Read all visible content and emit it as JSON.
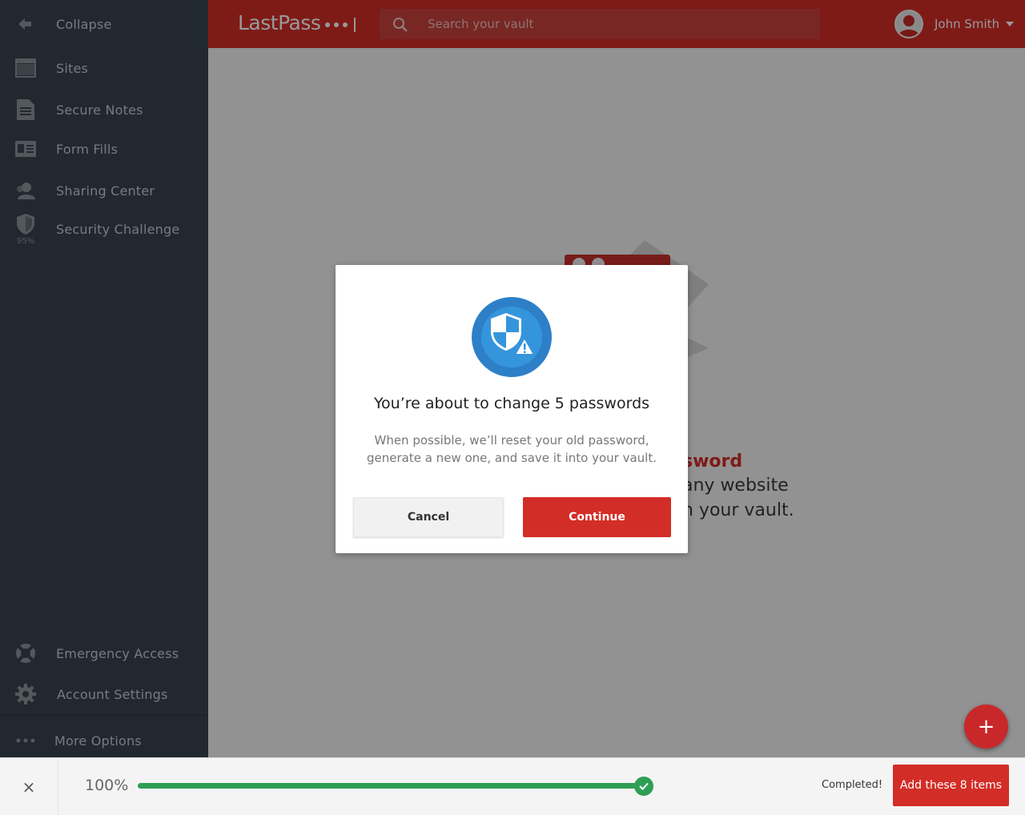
{
  "sidebar": {
    "collapse_label": "Collapse",
    "items": [
      {
        "label": "Sites",
        "icon": "sites-icon"
      },
      {
        "label": "Secure Notes",
        "icon": "secure-notes-icon"
      },
      {
        "label": "Form Fills",
        "icon": "form-fills-icon"
      },
      {
        "label": "Sharing Center",
        "icon": "sharing-center-icon"
      },
      {
        "label": "Security Challenge",
        "icon": "shield-icon",
        "score": "95%"
      }
    ],
    "bottom_items": [
      {
        "label": "Emergency Access",
        "icon": "lifebuoy-icon"
      },
      {
        "label": "Account Settings",
        "icon": "gear-icon"
      },
      {
        "label": "More Options",
        "icon": "more-dots-icon"
      }
    ]
  },
  "header": {
    "logo": "LastPass",
    "search_placeholder": "Search your vault",
    "user_name": "John Smith"
  },
  "background": {
    "highlight": "sword",
    "line2": "any website",
    "line3": "n your vault."
  },
  "modal": {
    "title": "You’re about to change 5 passwords",
    "body": "When possible, we’ll reset your old password, generate a new one, and save it into your vault.",
    "cancel_label": "Cancel",
    "continue_label": "Continue"
  },
  "fab": {
    "label": "+"
  },
  "bottom_bar": {
    "close_label": "×",
    "progress_text": "100%",
    "progress_value": 1.0,
    "status": "Completed!",
    "action_label": "Add these 8 items"
  },
  "colors": {
    "brand_red": "#d32d27",
    "sidebar_bg": "#3a4350",
    "shield_blue": "#2d80c8",
    "progress_green": "#2f9e55"
  }
}
